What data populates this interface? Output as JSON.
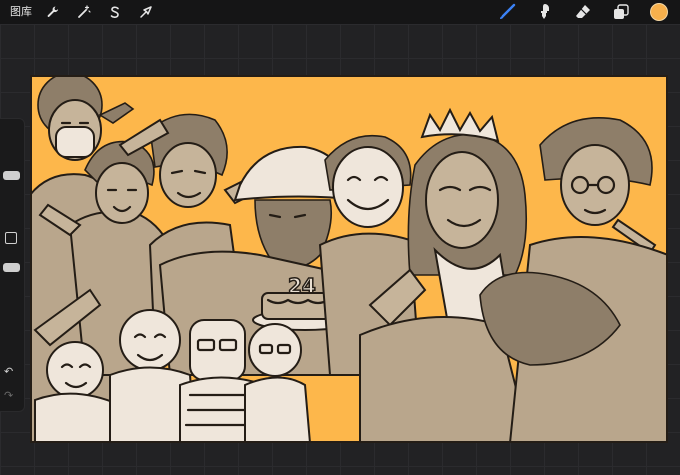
{
  "toolbar": {
    "gallery_label": "图库",
    "actions_icon": "wrench-icon",
    "adjustments_icon": "magic-wand-icon",
    "selection_icon": "selection-s-icon",
    "transform_icon": "arrow-cursor-icon",
    "brush_icon": "brush-icon",
    "smudge_icon": "smudge-icon",
    "eraser_icon": "eraser-icon",
    "layers_icon": "layers-icon",
    "current_color": "#f7b04c"
  },
  "sidebar": {
    "undo_icon": "undo-icon",
    "redo_icon": "redo-icon"
  },
  "canvas": {
    "background_color": "#fdb74b",
    "ink_color": "#c6b49a",
    "jersey_number": "24"
  }
}
